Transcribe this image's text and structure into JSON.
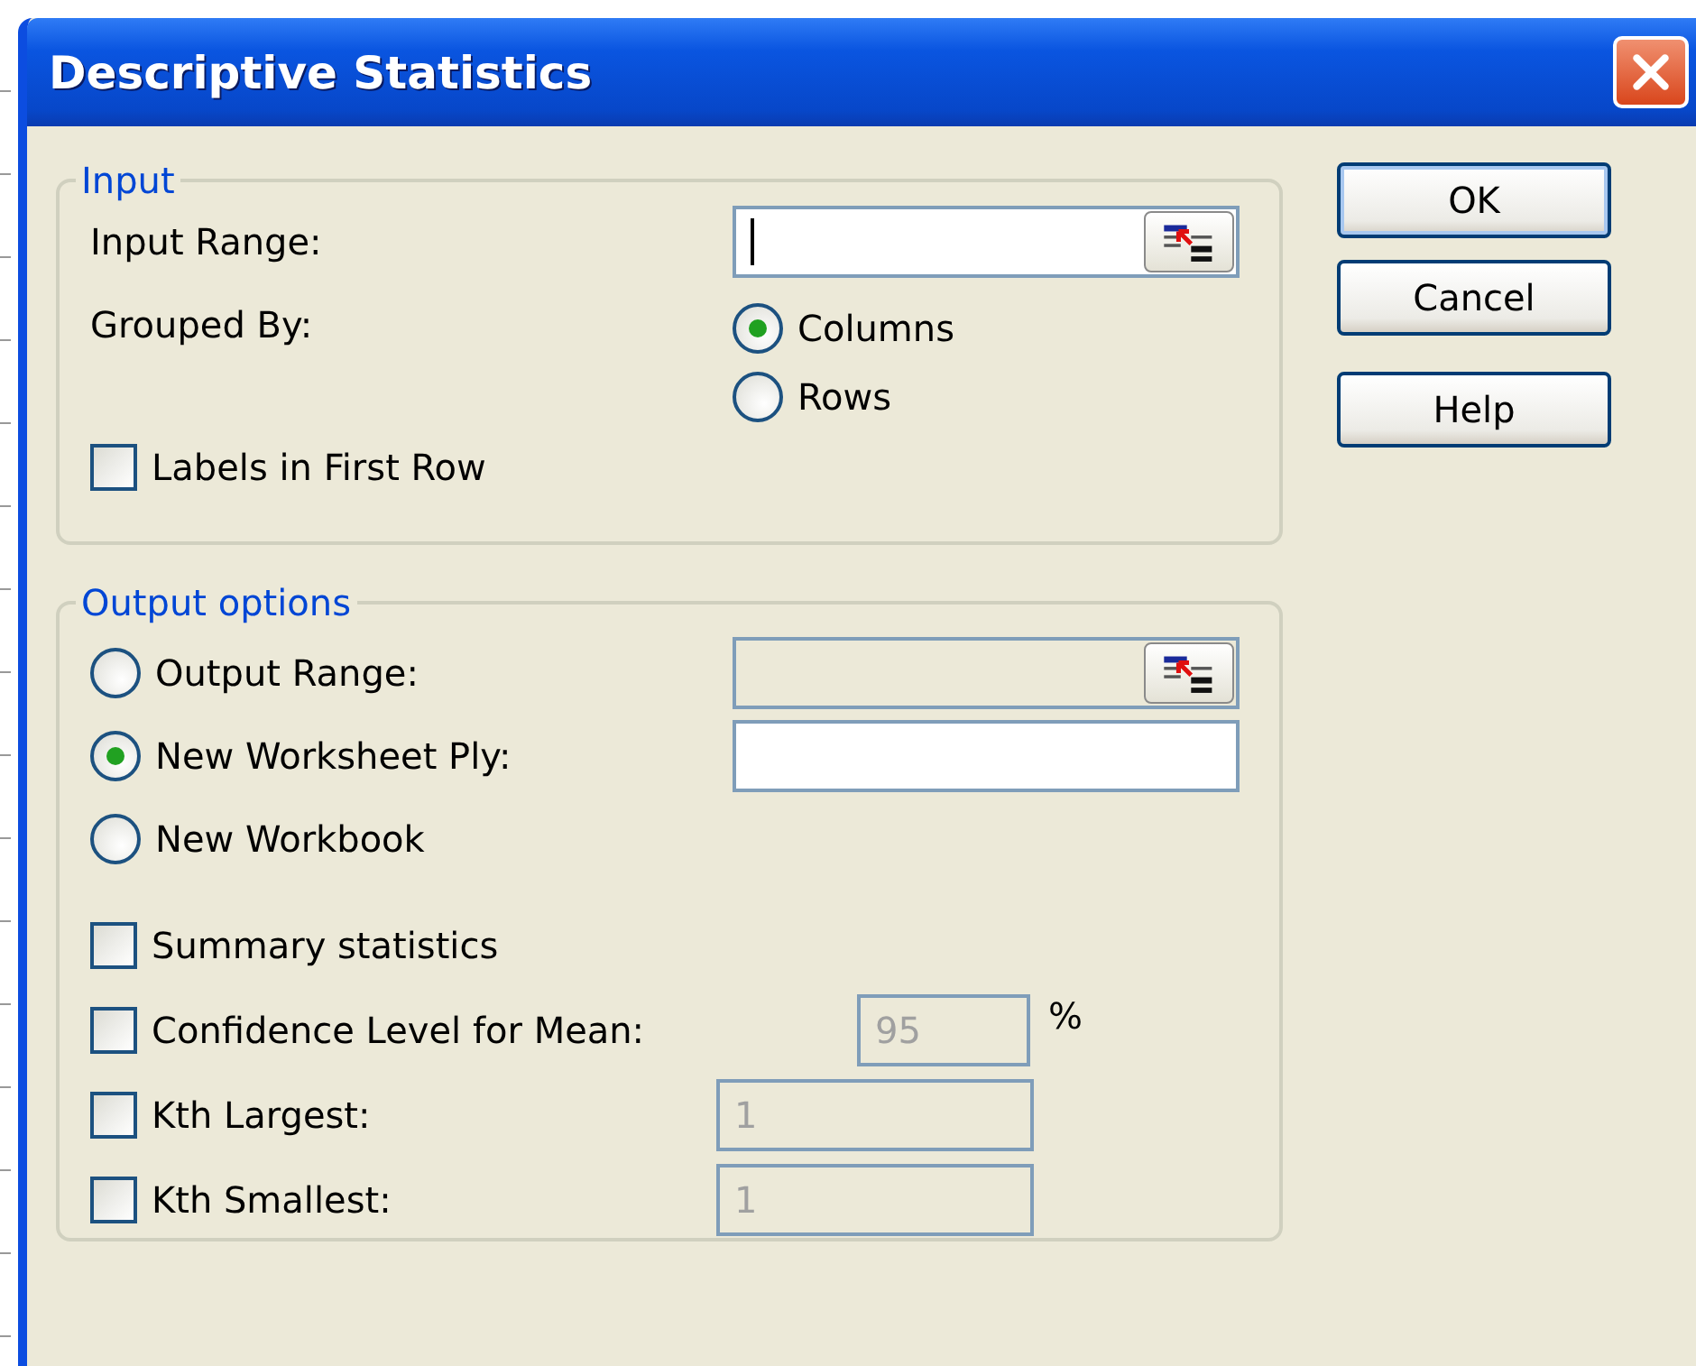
{
  "window": {
    "title": "Descriptive Statistics"
  },
  "input": {
    "title": "Input",
    "input_range": {
      "label": "Input Range:",
      "focused": true,
      "picker": true
    },
    "grouped_by": {
      "label": "Grouped By:",
      "options": [
        {
          "label": "Columns",
          "selected": true
        },
        {
          "label": "Rows",
          "selected": false
        }
      ]
    },
    "labels_in_first_row": {
      "label": "Labels in First Row",
      "checked": false
    }
  },
  "output": {
    "title": "Output options",
    "destinations": [
      {
        "label": "Output Range:",
        "selected": false,
        "field": {
          "disabled": true,
          "picker": true
        }
      },
      {
        "label": "New Worksheet Ply:",
        "selected": true,
        "field": {
          "disabled": false,
          "picker": false
        }
      },
      {
        "label": "New Workbook",
        "selected": false
      }
    ],
    "statistics": [
      {
        "kind": "plain",
        "label": "Summary statistics",
        "checked": false
      },
      {
        "kind": "percent",
        "label": "Confidence Level for Mean:",
        "checked": false,
        "field": {
          "value": "95",
          "disabled": true
        },
        "unit": "%"
      },
      {
        "kind": "rank",
        "label": "Kth Largest:",
        "checked": false,
        "field": {
          "value": "1",
          "disabled": true
        }
      },
      {
        "kind": "rank",
        "label": "Kth Smallest:",
        "checked": false,
        "field": {
          "value": "1",
          "disabled": true
        }
      }
    ]
  },
  "buttons": [
    {
      "label": "OK",
      "default": true
    },
    {
      "label": "Cancel",
      "default": false
    },
    {
      "label": "Help",
      "default": false
    }
  ]
}
